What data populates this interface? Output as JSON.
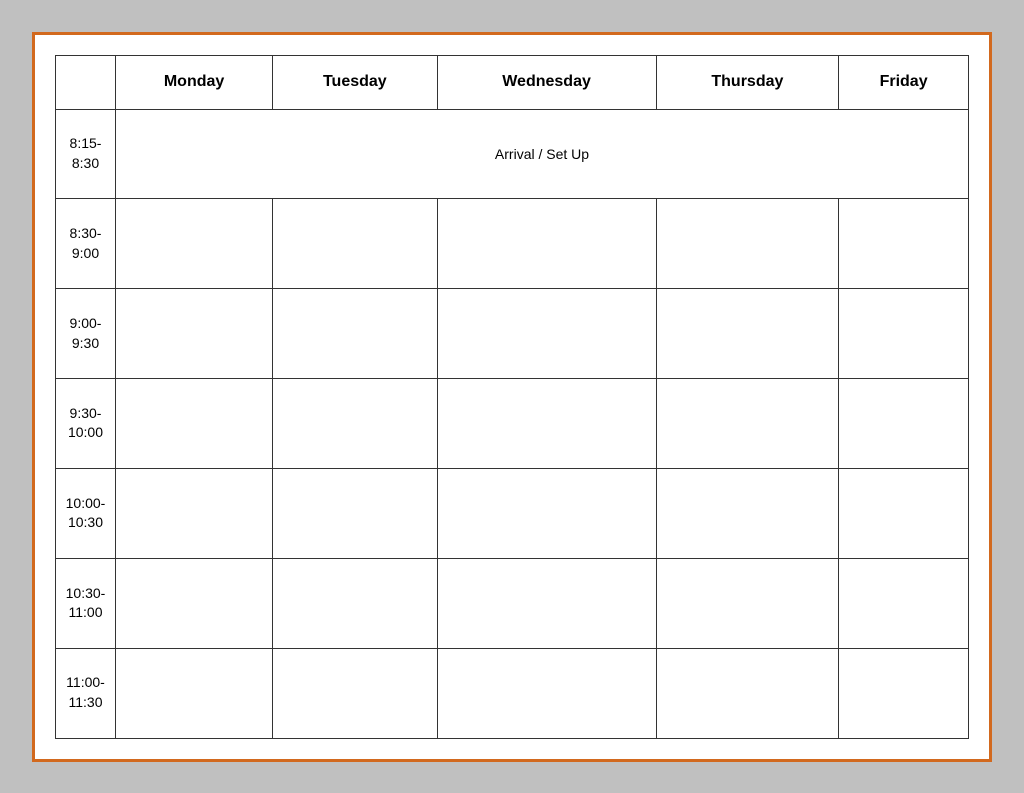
{
  "table": {
    "headers": {
      "time_col": "",
      "monday": "Monday",
      "tuesday": "Tuesday",
      "wednesday": "Wednesday",
      "thursday": "Thursday",
      "friday": "Friday"
    },
    "rows": [
      {
        "time": "8:15-\n8:30",
        "span_label": "Arrival / Set Up",
        "span": true
      },
      {
        "time": "8:30-\n9:00",
        "span": false
      },
      {
        "time": "9:00-\n9:30",
        "span": false
      },
      {
        "time": "9:30-\n10:00",
        "span": false
      },
      {
        "time": "10:00-\n10:30",
        "span": false
      },
      {
        "time": "10:30-\n11:00",
        "span": false
      },
      {
        "time": "11:00-\n11:30",
        "span": false
      }
    ]
  }
}
